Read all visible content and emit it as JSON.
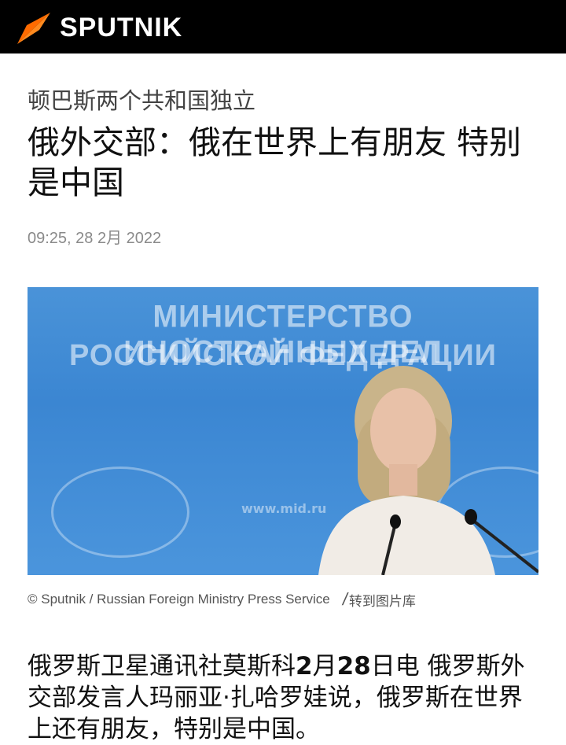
{
  "header": {
    "brand": "SPUTNIK",
    "brand_color": "#ff6b00",
    "background": "#000000"
  },
  "article": {
    "kicker": "顿巴斯两个共和国独立",
    "headline": "俄外交部：俄在世界上有朋友 特别是中国",
    "date": "09:25, 28 2月 2022",
    "photo": {
      "sign_line1": "МИНИСТЕРСТВО ИНОСТРАННЫХ ДЕЛ",
      "sign_line2": "РОССИЙСКОЙ ФЕДЕРАЦИИ",
      "sign_url": "www.mid.ru",
      "credit": "© Sputnik / Russian Foreign Ministry Press Service",
      "gallery_link": "转到图片库"
    },
    "lead_prefix": "俄罗斯卫星通讯社莫斯科",
    "lead_num1": "2",
    "lead_mid": "月",
    "lead_num2": "28",
    "lead_rest": "日电 俄罗斯外交部发言人玛丽亚·扎哈罗娃说，俄罗斯在世界上还有朋友，特别是中国。"
  }
}
